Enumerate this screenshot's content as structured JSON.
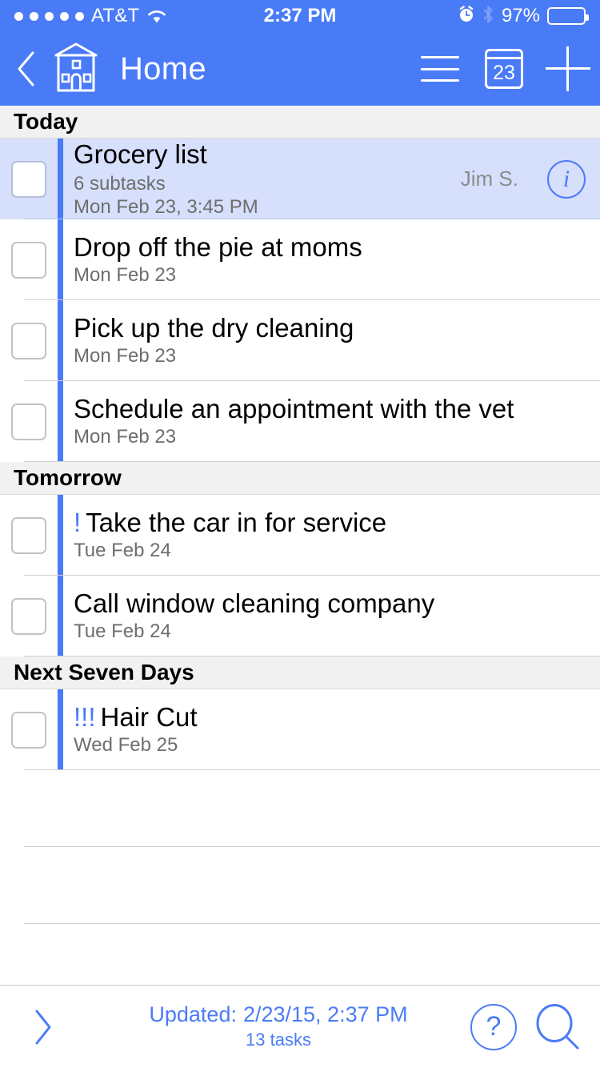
{
  "status_bar": {
    "signal_dots": 5,
    "carrier": "AT&T",
    "wifi_icon": "wifi-icon",
    "time": "2:37 PM",
    "alarm_icon": "alarm-clock-icon",
    "bluetooth_icon": "bluetooth-icon",
    "battery_percent": "97%",
    "battery_level": 97
  },
  "nav_bar": {
    "back_label": "back-chevron",
    "home_icon": "house-icon",
    "title": "Home",
    "menu_icon": "hamburger-menu-icon",
    "calendar_icon_day": "23",
    "add_icon": "plus-icon",
    "background_color": "#4a7bf7"
  },
  "sections": [
    {
      "title": "Today",
      "tasks": [
        {
          "title": "Grocery list",
          "priority": "",
          "subtasks": "6 subtasks",
          "due": "Mon Feb 23, 3:45 PM",
          "assignee": "Jim S.",
          "selected": true,
          "has_info_button": true,
          "info_icon": "info-circle-icon",
          "checked": false
        },
        {
          "title": "Drop off the pie at moms",
          "priority": "",
          "subtasks": "",
          "due": "Mon Feb 23",
          "assignee": "",
          "selected": false,
          "has_info_button": false,
          "checked": false
        },
        {
          "title": "Pick up the dry cleaning",
          "priority": "",
          "subtasks": "",
          "due": "Mon Feb 23",
          "assignee": "",
          "selected": false,
          "has_info_button": false,
          "checked": false
        },
        {
          "title": "Schedule an appointment with the vet",
          "priority": "",
          "subtasks": "",
          "due": "Mon Feb 23",
          "assignee": "",
          "selected": false,
          "has_info_button": false,
          "checked": false
        }
      ]
    },
    {
      "title": "Tomorrow",
      "tasks": [
        {
          "title": "Take the car in for service",
          "priority": "!",
          "subtasks": "",
          "due": "Tue Feb 24",
          "assignee": "",
          "selected": false,
          "has_info_button": false,
          "checked": false
        },
        {
          "title": "Call window cleaning company",
          "priority": "",
          "subtasks": "",
          "due": "Tue Feb 24",
          "assignee": "",
          "selected": false,
          "has_info_button": false,
          "checked": false
        }
      ]
    },
    {
      "title": "Next Seven Days",
      "tasks": [
        {
          "title": "Hair Cut",
          "priority": "!!!",
          "subtasks": "",
          "due": "Wed Feb 25",
          "assignee": "",
          "selected": false,
          "has_info_button": false,
          "checked": false
        }
      ]
    }
  ],
  "empty_rows": 3,
  "footer": {
    "expand_icon": "chevron-right-icon",
    "updated_label": "Updated:",
    "updated_value": "2/23/15, 2:37 PM",
    "task_count": "13 tasks",
    "help_label": "?",
    "help_icon": "help-circle-icon",
    "search_icon": "search-icon"
  },
  "colors": {
    "accent_blue": "#4a7bf7",
    "selected_row": "#d6dffb",
    "section_header_bg": "#f1f1f1",
    "secondary_text": "#6e6e6e"
  }
}
